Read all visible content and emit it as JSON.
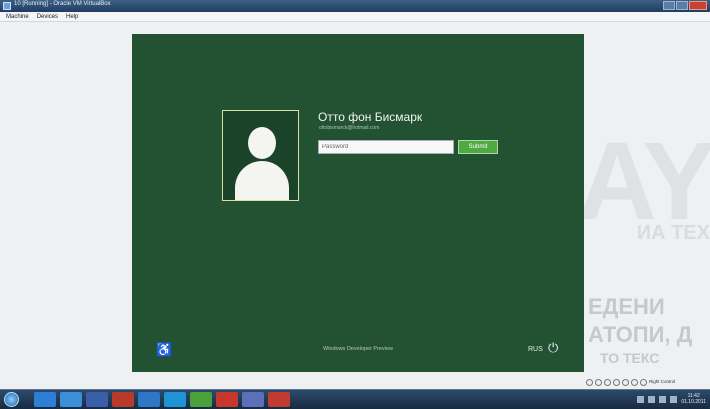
{
  "host_window": {
    "title": "10 [Running] - Oracle VM VirtualBox",
    "menu": [
      "Machine",
      "Devices",
      "Help"
    ]
  },
  "host_background": {
    "big_text": "AY",
    "sub_text": "ИА ТЕХ",
    "line1": "ЕДЕНИ",
    "line2": "АТОПИ, Д",
    "line3": "ТО ТЕКС"
  },
  "lock_screen": {
    "user_name": "Отто фон Бисмарк",
    "user_email": "ottobismarck@hotmail.com",
    "password_placeholder": "Password",
    "submit_label": "Submit",
    "footer_text": "Windows Developer Preview",
    "language": "RUS",
    "ease_of_access_icon": "ease-of-access-icon",
    "power_icon": "power-icon"
  },
  "host_status": {
    "right_ctrl_label": "Right Control"
  },
  "taskbar": {
    "clock_time": "11:42",
    "clock_date": "01.10.2011"
  },
  "colors": {
    "guest_background": "#235233",
    "submit_button": "#4faa44"
  }
}
